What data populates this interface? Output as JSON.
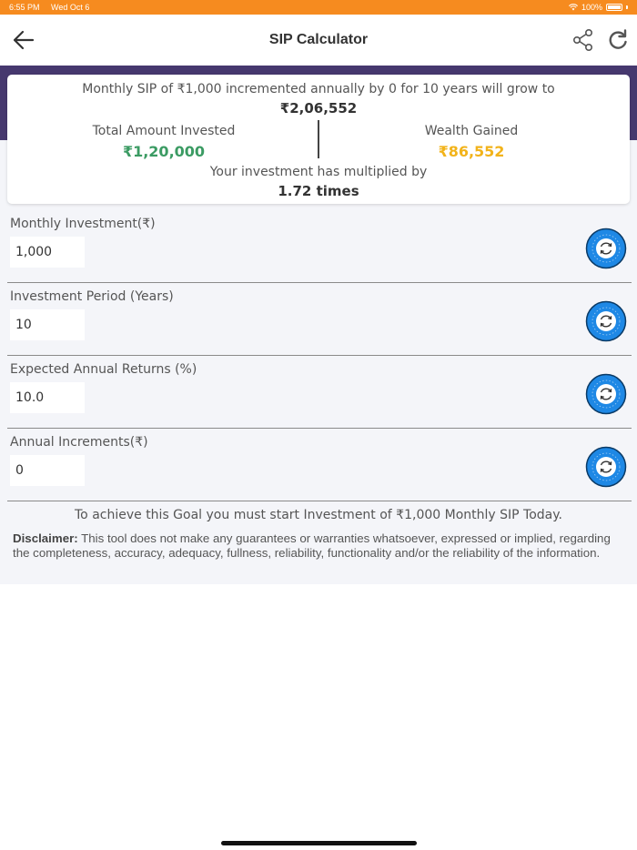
{
  "status_bar": {
    "time": "6:55 PM",
    "date": "Wed Oct 6",
    "battery": "100%",
    "color": "#f68b1f"
  },
  "nav": {
    "title": "SIP Calculator",
    "back_icon": "arrow-left-icon",
    "share_icon": "share-icon",
    "refresh_icon": "refresh-icon"
  },
  "summary": {
    "headline": "Monthly SIP of ₹1,000 incremented annually by 0 for 10 years will grow to",
    "total_value": "₹2,06,552",
    "invested_label": "Total Amount Invested",
    "invested_value": "₹1,20,000",
    "gained_label": "Wealth Gained",
    "gained_value": "₹86,552",
    "multiplier_label": "Your investment has multiplied by",
    "multiplier_value": "1.72 times"
  },
  "fields": [
    {
      "label": "Monthly Investment(₹)",
      "value": "1,000"
    },
    {
      "label": "Investment Period (Years)",
      "value": "10"
    },
    {
      "label": "Expected Annual Returns (%)",
      "value": "10.0"
    },
    {
      "label": "Annual Increments(₹)",
      "value": "0"
    }
  ],
  "goal_text": "To achieve this Goal you must start Investment of ₹1,000 Monthly SIP Today.",
  "disclaimer": {
    "label": "Disclaimer:",
    "text": " This tool does not make any guarantees or warranties whatsoever, expressed or implied, regarding the completeness, accuracy, adequacy, fullness, reliability, functionality and/or the reliability of the information."
  },
  "colors": {
    "accent": "#f68b1f",
    "header_band": "#46386e",
    "invested": "#3b9b63",
    "gained": "#f2b31a",
    "reset_button": "#1e88e5"
  }
}
